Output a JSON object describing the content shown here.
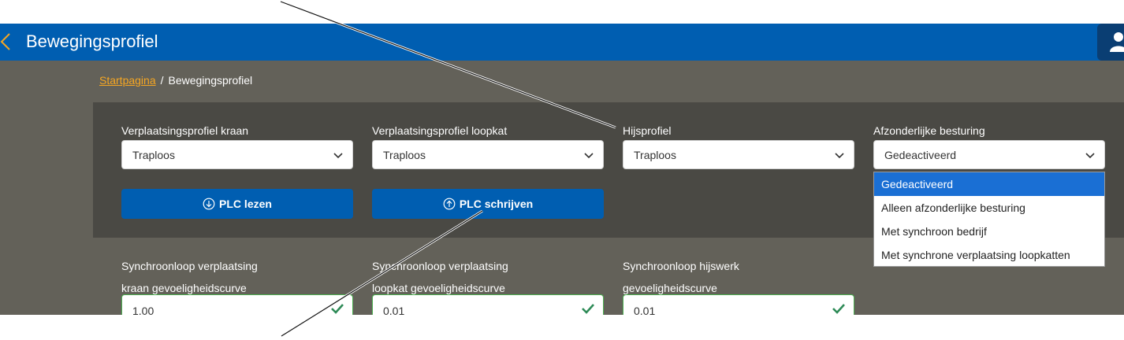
{
  "header": {
    "title": "Bewegingsprofiel",
    "back_icon": "chevron-left-icon",
    "user_icon": "user-icon"
  },
  "breadcrumb": {
    "home": "Startpagina",
    "separator": "/",
    "current": "Bewegingsprofiel"
  },
  "profiles": [
    {
      "label": "Verplaatsingsprofiel kraan",
      "value": "Traploos"
    },
    {
      "label": "Verplaatsingsprofiel loopkat",
      "value": "Traploos"
    },
    {
      "label": "Hijsprofiel",
      "value": "Traploos"
    },
    {
      "label": "Afzonderlijke besturing",
      "value": "Gedeactiveerd"
    }
  ],
  "buttons": {
    "read": "PLC lezen",
    "write": "PLC schrijven"
  },
  "dropdown": {
    "options": [
      "Gedeactiveerd",
      "Alleen afzonderlijke besturing",
      "Met synchroon bedrijf",
      "Met synchrone verplaatsing loopkatten"
    ],
    "selected_index": 0
  },
  "sync": [
    {
      "label_line1": "Synchroonloop verplaatsing",
      "label_line2": "kraan gevoeligheidscurve",
      "value": "1,00"
    },
    {
      "label_line1": "Synchroonloop verplaatsing",
      "label_line2": "loopkat gevoeligheidscurve",
      "value": "0,01"
    },
    {
      "label_line1": "Synchroonloop hijswerk",
      "label_line2": "gevoeligheidscurve",
      "value": "0,01"
    }
  ],
  "colors": {
    "topbar": "#005eb1",
    "accent": "#f5a623",
    "main_bg": "#636159",
    "panel_bg": "#4a4944",
    "button": "#005eb1",
    "selected_option": "#1a6fd4",
    "valid": "#2e8b57"
  }
}
